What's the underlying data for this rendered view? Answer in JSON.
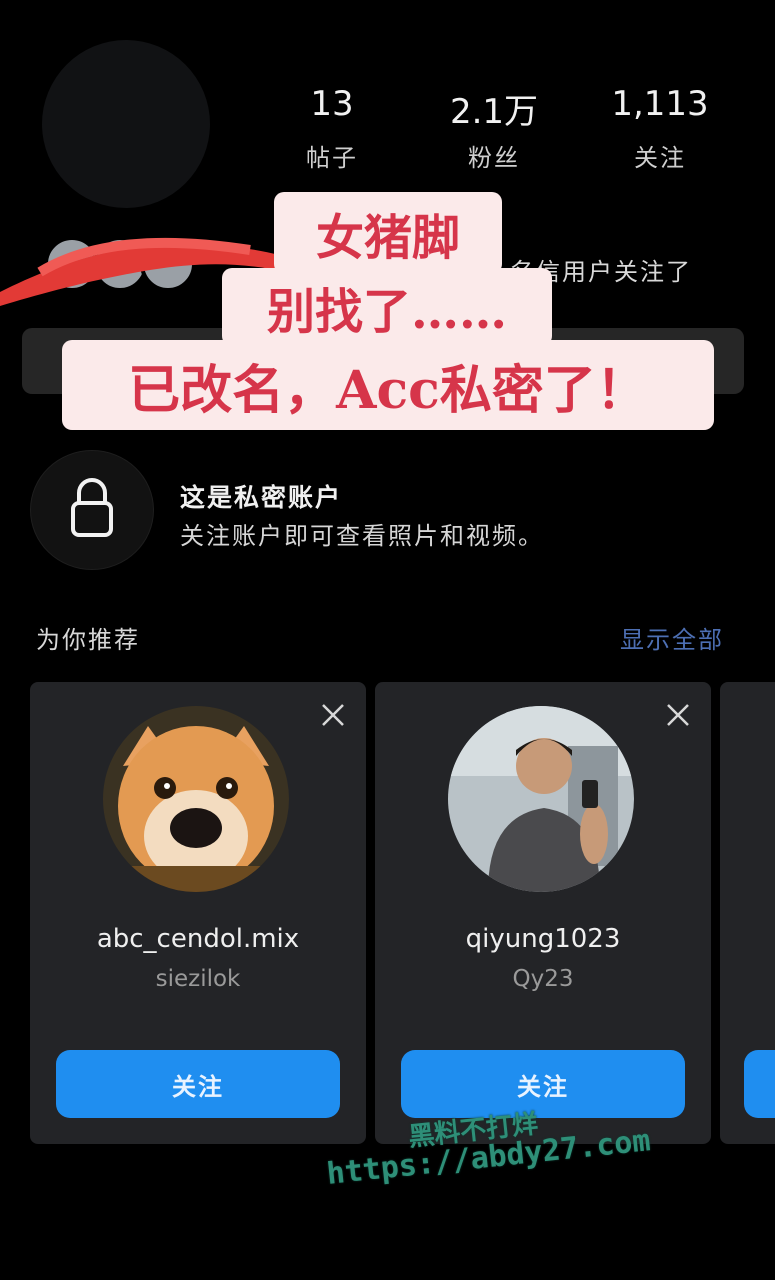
{
  "profile": {
    "stats": [
      {
        "value": "13",
        "label": "帖子"
      },
      {
        "value": "2.1万",
        "label": "粉丝"
      },
      {
        "value": "1,113",
        "label": "关注"
      }
    ],
    "followed_by_text": "名信用户关注了"
  },
  "overlay_caption": {
    "line1": "女猪脚",
    "line2": "别找了……",
    "line3": "已改名，Acc私密了！"
  },
  "private_notice": {
    "title": "这是私密账户",
    "description": "关注账户即可查看照片和视频。",
    "icon": "lock-icon"
  },
  "recommendations": {
    "title": "为你推荐",
    "see_all": "显示全部",
    "cards": [
      {
        "username": "abc_cendol.mix",
        "display_name": "siezilok",
        "follow_label": "关注"
      },
      {
        "username": "qiyung1023",
        "display_name": "Qy23",
        "follow_label": "关注"
      }
    ]
  },
  "watermark": {
    "line1": "黑料不打烊",
    "line2": "https://abdy27.com"
  },
  "colors": {
    "background": "#000000",
    "card": "#232427",
    "follow_button": "#1f8ef0",
    "caption_text": "#d6354a",
    "caption_bg": "#fbeaea",
    "see_all": "#4d6fb3",
    "watermark": "#2e8f78"
  }
}
